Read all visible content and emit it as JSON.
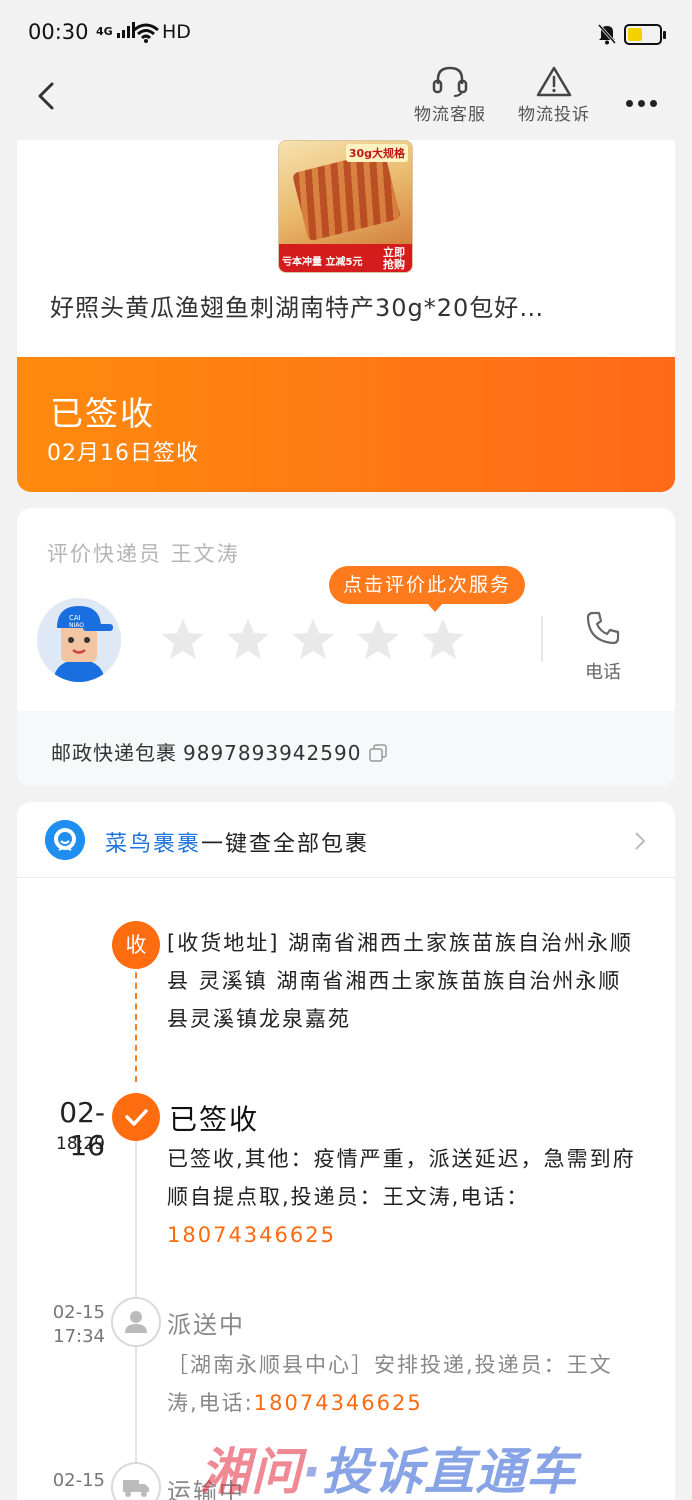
{
  "status_bar": {
    "time": "00:30",
    "signal": "4G",
    "network": "HD",
    "battery_fill": 0.4,
    "battery_color": "#f5d000"
  },
  "nav": {
    "back_icon": "chevron-left-icon",
    "actions": [
      {
        "label": "物流客服",
        "icon": "headset-icon"
      },
      {
        "label": "物流投诉",
        "icon": "warning-icon"
      }
    ],
    "more_icon": "more-dots-icon"
  },
  "product": {
    "image_tag": "30g大规格",
    "image_promo": "亏本冲量 立减5元",
    "image_cta": "立即抢购",
    "title": "好照头黄瓜渔翅鱼刺湖南特产30g*20包好…"
  },
  "delivery_status": {
    "title": "已签收",
    "subtitle": "02月16日签收",
    "gradient_start": "#ff8a0e",
    "gradient_end": "#ff6a18"
  },
  "courier": {
    "rate_title": "评价快递员  王文涛",
    "hint": "点击评价此次服务",
    "stars": 5,
    "stars_filled": 0,
    "phone_label": "电话",
    "tracking_label": "邮政快递包裹",
    "tracking_number": "9897893942590"
  },
  "cainiao": {
    "brand": "菜鸟裹裹",
    "text": "一键查全部包裹"
  },
  "timeline": {
    "accent": "#ff6d10",
    "address": {
      "node_label": "收",
      "text": "[收货地址] 湖南省湘西土家族苗族自治州永顺县 灵溪镇    湖南省湘西土家族苗族自治州永顺县灵溪镇龙泉嘉苑"
    },
    "events": [
      {
        "date": "02-16",
        "time": "18:29",
        "title": "已签收",
        "body": "已签收,其他：疫情严重，派送延迟，急需到府顺自提点取,投递员：王文涛,电话：",
        "phone": "18074346625"
      },
      {
        "date": "02-15",
        "time": "17:34",
        "title": "派送中",
        "body": "［湖南永顺县中心］安排投递,投递员：王文涛,电话:",
        "phone": "18074346625"
      },
      {
        "date": "02-15",
        "title": "运输中"
      }
    ]
  },
  "watermark": {
    "part1": "湘问",
    "dot": "·",
    "part2": "投诉直通车"
  }
}
